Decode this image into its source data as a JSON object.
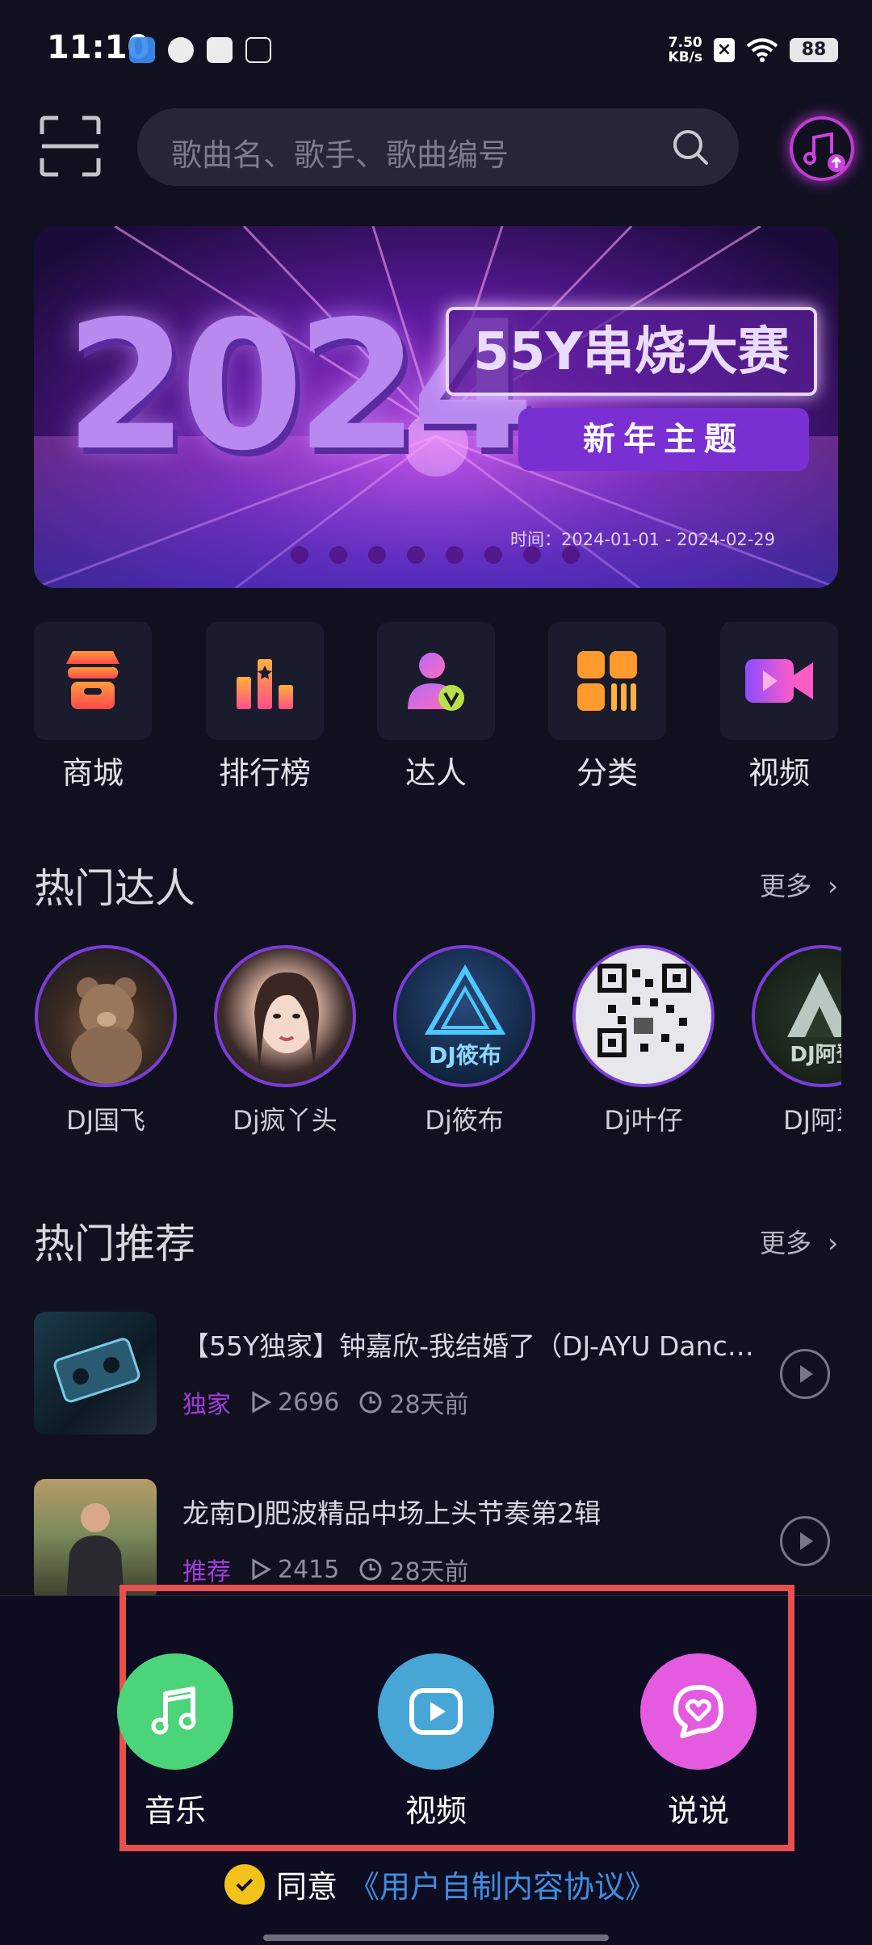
{
  "status_bar": {
    "time": "11:10",
    "net_speed_value": "7.50",
    "net_speed_unit": "KB/s",
    "battery": "88"
  },
  "search": {
    "placeholder": "歌曲名、歌手、歌曲编号"
  },
  "banner": {
    "year": "2024",
    "title": "55Y串烧大赛",
    "subtitle": "新年主题",
    "time_label": "时间：2024-01-01 - 2024-02-29",
    "dot_count": 8
  },
  "quick_nav": {
    "items": [
      {
        "label": "商城",
        "icon": "store-icon"
      },
      {
        "label": "排行榜",
        "icon": "chart-icon"
      },
      {
        "label": "达人",
        "icon": "talent-icon"
      },
      {
        "label": "分类",
        "icon": "category-icon"
      },
      {
        "label": "视频",
        "icon": "video-icon"
      }
    ]
  },
  "hot_djs": {
    "title": "热门达人",
    "more": "更多",
    "items": [
      {
        "name": "DJ国飞"
      },
      {
        "name": "Dj疯丫头"
      },
      {
        "name": "Dj筱布"
      },
      {
        "name": "Dj叶仔"
      },
      {
        "name": "DJ阿登"
      }
    ]
  },
  "hot_recommend": {
    "title": "热门推荐",
    "more": "更多",
    "songs": [
      {
        "title": "【55Y独家】钟嘉欣-我结婚了（DJ-AYU Danc…",
        "tag": "独家",
        "plays": "2696",
        "time": "28天前"
      },
      {
        "title": "龙南DJ肥波精品中场上头节奏第2辑",
        "tag": "推荐",
        "plays": "2415",
        "time": "28天前"
      }
    ]
  },
  "post_options": {
    "items": [
      {
        "label": "音乐",
        "color": "#4cd47a",
        "icon": "music-note-icon"
      },
      {
        "label": "视频",
        "color": "#47a6d6",
        "icon": "play-icon"
      },
      {
        "label": "说说",
        "color": "#e45be0",
        "icon": "heart-chat-icon"
      }
    ]
  },
  "agreement": {
    "text": "同意",
    "link": "《用户自制内容协议》"
  }
}
